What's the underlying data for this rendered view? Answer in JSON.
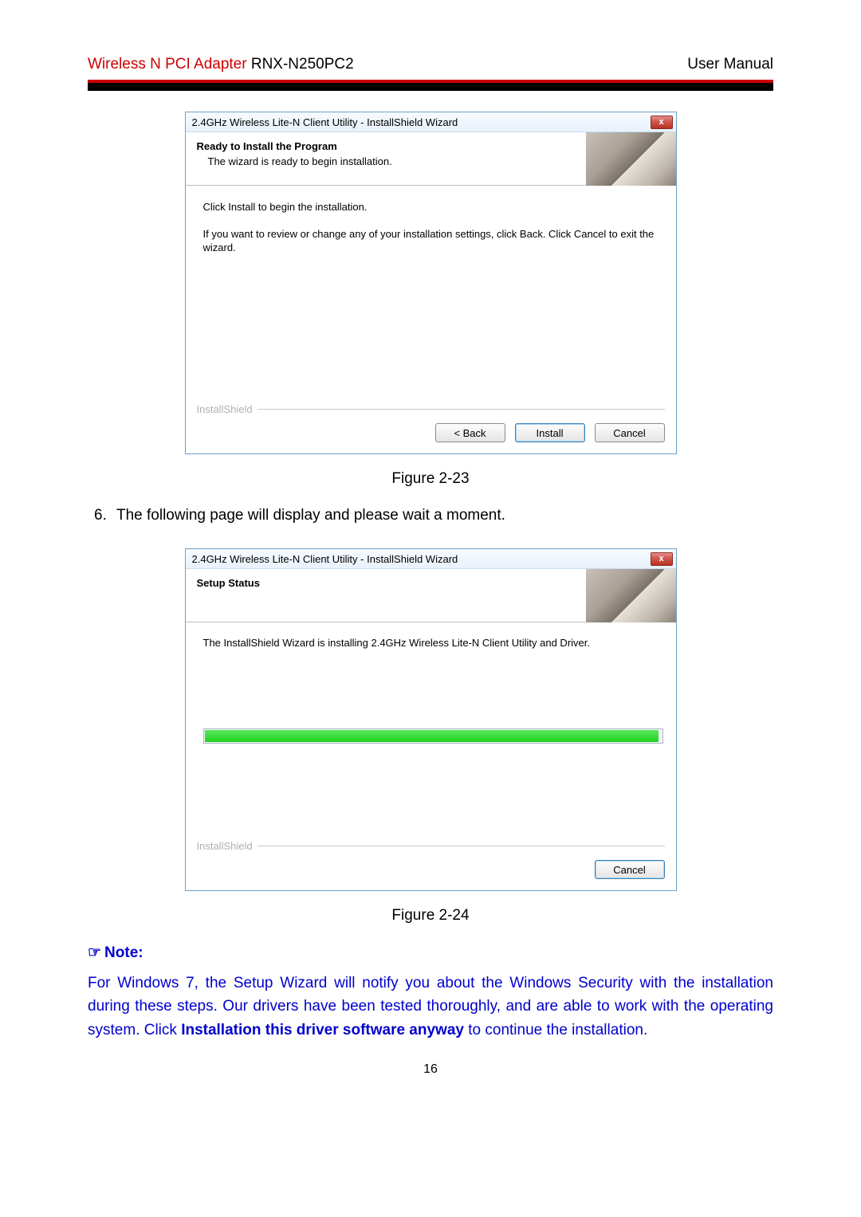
{
  "header": {
    "product": "Wireless N PCI Adapter",
    "model": " RNX-N250PC2",
    "manual": "User Manual"
  },
  "dialog1": {
    "title": "2.4GHz Wireless Lite-N Client Utility - InstallShield Wizard",
    "close": "x",
    "heading": "Ready to Install the Program",
    "sub": "The wizard is ready to begin installation.",
    "line1": "Click Install to begin the installation.",
    "line2": "If you want to review or change any of your installation settings, click Back. Click Cancel to exit the wizard.",
    "brand": "InstallShield",
    "back": "< Back",
    "install": "Install",
    "cancel": "Cancel"
  },
  "caption1": "Figure 2-23",
  "step6": {
    "num": "6.",
    "text": "The following page will display and please wait a moment."
  },
  "dialog2": {
    "title": "2.4GHz Wireless Lite-N Client Utility - InstallShield Wizard",
    "close": "x",
    "heading": "Setup Status",
    "line1": "The InstallShield Wizard is installing 2.4GHz Wireless Lite-N Client Utility and Driver.",
    "brand": "InstallShield",
    "cancel": "Cancel"
  },
  "caption2": "Figure 2-24",
  "note": {
    "icon": "☞",
    "label": "Note:",
    "body_pre": "For Windows 7, the Setup Wizard will notify you about the Windows Security with the installation during these steps. Our drivers have been tested thoroughly, and are able to work with the operating system. Click ",
    "body_bold": "Installation this driver software anyway",
    "body_post": " to continue the installation."
  },
  "page_num": "16"
}
